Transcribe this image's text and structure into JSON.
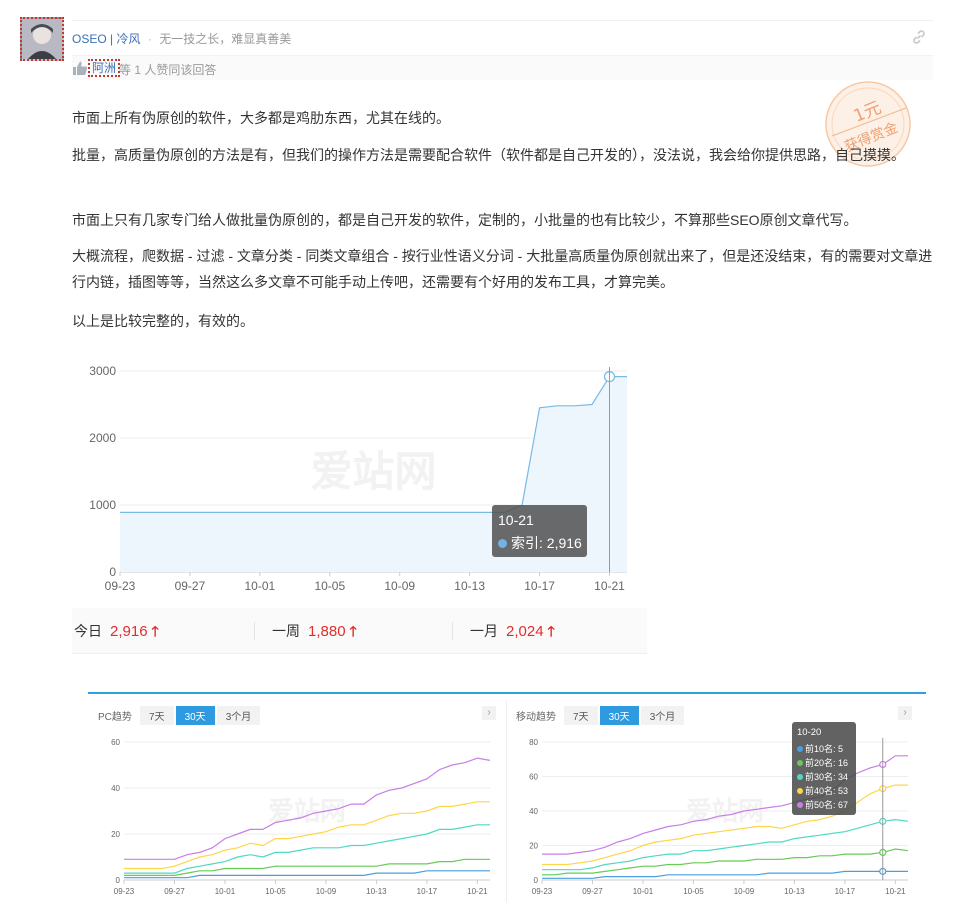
{
  "header": {
    "user_name": "OSEO",
    "separator": "|",
    "user_alias": "冷风",
    "dot": "·",
    "motto": "无一技之长，难显真善美",
    "voter": "阿洲",
    "vote_text": "等 1 人赞同该回答",
    "stamp_line1": "1元",
    "stamp_line2": "获得赏金"
  },
  "answer": {
    "paragraphs": [
      "市面上所有伪原创的软件，大多都是鸡肋东西，尤其在线的。",
      "批量，高质量伪原创的方法是有，但我们的操作方法是需要配合软件（软件都是自己开发的），没法说，我会给你提供思路，自己摸摸。",
      "市面上只有几家专门给人做批量伪原创的，都是自己开发的软件，定制的，小批量的也有比较少，不算那些SEO原创文章代写。",
      "大概流程，爬数据 - 过滤 - 文章分类 - 同类文章组合 - 按行业性语义分词 - 大批量高质量伪原创就出来了，但是还没结束，有的需要对文章进行内链，插图等等，当然这么多文章不可能手动上传吧，还需要有个好用的发布工具，才算完美。",
      "以上是比较完整的，有效的。"
    ]
  },
  "chart_data": [
    {
      "type": "area",
      "x": [
        "09-23",
        "09-24",
        "09-25",
        "09-26",
        "09-27",
        "09-28",
        "09-29",
        "09-30",
        "10-01",
        "10-02",
        "10-03",
        "10-04",
        "10-05",
        "10-06",
        "10-07",
        "10-08",
        "10-09",
        "10-10",
        "10-11",
        "10-12",
        "10-13",
        "10-14",
        "10-15",
        "10-16",
        "10-17",
        "10-18",
        "10-19",
        "10-20",
        "10-21",
        "10-22"
      ],
      "series": [
        {
          "name": "索引",
          "values": [
            890,
            890,
            890,
            890,
            890,
            890,
            890,
            890,
            890,
            890,
            890,
            890,
            890,
            890,
            890,
            890,
            890,
            890,
            890,
            890,
            890,
            890,
            890,
            1000,
            2450,
            2480,
            2480,
            2500,
            2916,
            2916
          ]
        }
      ],
      "xticks": [
        "09-23",
        "09-27",
        "10-01",
        "10-05",
        "10-09",
        "10-13",
        "10-17",
        "10-21"
      ],
      "yticks": [
        "0",
        "1000",
        "2000",
        "3000"
      ],
      "ylim": [
        0,
        3000
      ],
      "watermark": "爱站网",
      "tooltip": {
        "date": "10-21",
        "label": "索引: 2,916"
      }
    },
    {
      "type": "line",
      "title": "PC趋势",
      "x": [
        "09-23",
        "09-24",
        "09-25",
        "09-26",
        "09-27",
        "09-28",
        "09-29",
        "09-30",
        "10-01",
        "10-02",
        "10-03",
        "10-04",
        "10-05",
        "10-06",
        "10-07",
        "10-08",
        "10-09",
        "10-10",
        "10-11",
        "10-12",
        "10-13",
        "10-14",
        "10-15",
        "10-16",
        "10-17",
        "10-18",
        "10-19",
        "10-20",
        "10-21",
        "10-22"
      ],
      "xticks": [
        "09-23",
        "09-27",
        "10-01",
        "10-05",
        "10-09",
        "10-13",
        "10-17",
        "10-21"
      ],
      "yticks": [
        "0",
        "20",
        "40",
        "60"
      ],
      "ylim": [
        0,
        60
      ],
      "watermark": "爱站网",
      "series": [
        {
          "name": "前10名",
          "color": "#4a9fe0",
          "values": [
            1,
            1,
            1,
            1,
            1,
            1,
            2,
            2,
            2,
            2,
            2,
            2,
            2,
            2,
            2,
            2,
            2,
            2,
            2,
            2,
            3,
            3,
            3,
            3,
            4,
            4,
            4,
            4,
            4,
            4
          ]
        },
        {
          "name": "前20名",
          "color": "#66cc55",
          "values": [
            2,
            2,
            2,
            2,
            2,
            3,
            4,
            4,
            5,
            5,
            5,
            5,
            6,
            6,
            6,
            6,
            6,
            6,
            6,
            6,
            6,
            7,
            7,
            7,
            7,
            8,
            8,
            9,
            9,
            9
          ]
        },
        {
          "name": "前30名",
          "color": "#4fd9c4",
          "values": [
            3,
            3,
            3,
            3,
            3,
            5,
            6,
            7,
            8,
            10,
            11,
            10,
            12,
            12,
            13,
            14,
            14,
            14,
            15,
            15,
            16,
            17,
            18,
            19,
            20,
            22,
            22,
            23,
            24,
            24
          ]
        },
        {
          "name": "前40名",
          "color": "#ffd54a",
          "values": [
            5,
            5,
            5,
            5,
            6,
            8,
            10,
            11,
            13,
            14,
            16,
            15,
            18,
            18,
            19,
            20,
            21,
            23,
            24,
            24,
            26,
            28,
            29,
            29,
            30,
            32,
            32,
            33,
            34,
            34
          ]
        },
        {
          "name": "前50名",
          "color": "#c77ee8",
          "values": [
            9,
            9,
            9,
            9,
            9,
            11,
            12,
            14,
            18,
            20,
            22,
            22,
            25,
            26,
            27,
            29,
            30,
            31,
            33,
            33,
            37,
            39,
            40,
            42,
            44,
            48,
            50,
            51,
            53,
            52
          ]
        }
      ]
    },
    {
      "type": "line",
      "title": "移动趋势",
      "x": [
        "09-23",
        "09-24",
        "09-25",
        "09-26",
        "09-27",
        "09-28",
        "09-29",
        "09-30",
        "10-01",
        "10-02",
        "10-03",
        "10-04",
        "10-05",
        "10-06",
        "10-07",
        "10-08",
        "10-09",
        "10-10",
        "10-11",
        "10-12",
        "10-13",
        "10-14",
        "10-15",
        "10-16",
        "10-17",
        "10-18",
        "10-19",
        "10-20",
        "10-21",
        "10-22"
      ],
      "xticks": [
        "09-23",
        "09-27",
        "10-01",
        "10-05",
        "10-09",
        "10-13",
        "10-17",
        "10-21"
      ],
      "yticks": [
        "0",
        "20",
        "40",
        "60",
        "80"
      ],
      "ylim": [
        0,
        80
      ],
      "watermark": "爱站网",
      "series": [
        {
          "name": "前10名",
          "color": "#4a9fe0",
          "values": [
            1,
            1,
            1,
            1,
            1,
            2,
            2,
            2,
            2,
            2,
            3,
            3,
            3,
            3,
            3,
            3,
            3,
            3,
            4,
            4,
            4,
            4,
            4,
            4,
            5,
            5,
            5,
            5,
            5,
            5
          ]
        },
        {
          "name": "前20名",
          "color": "#66cc55",
          "values": [
            3,
            3,
            4,
            4,
            4,
            5,
            6,
            7,
            8,
            8,
            9,
            9,
            10,
            10,
            11,
            11,
            11,
            12,
            12,
            12,
            13,
            13,
            14,
            14,
            15,
            15,
            15,
            16,
            18,
            17
          ]
        },
        {
          "name": "前30名",
          "color": "#4fd9c4",
          "values": [
            6,
            6,
            6,
            6,
            7,
            9,
            10,
            11,
            13,
            14,
            15,
            15,
            17,
            17,
            18,
            19,
            20,
            21,
            22,
            22,
            24,
            25,
            26,
            27,
            28,
            30,
            32,
            34,
            35,
            34
          ]
        },
        {
          "name": "前40名",
          "color": "#ffd54a",
          "values": [
            9,
            9,
            9,
            10,
            11,
            13,
            15,
            17,
            20,
            22,
            23,
            24,
            26,
            27,
            28,
            29,
            30,
            31,
            31,
            30,
            32,
            34,
            35,
            37,
            40,
            45,
            50,
            53,
            55,
            55
          ]
        },
        {
          "name": "前50名",
          "color": "#c77ee8",
          "values": [
            15,
            15,
            15,
            16,
            17,
            19,
            22,
            24,
            27,
            29,
            31,
            32,
            34,
            35,
            37,
            38,
            40,
            41,
            42,
            43,
            45,
            47,
            48,
            52,
            58,
            62,
            65,
            67,
            72,
            72
          ]
        }
      ],
      "tooltip": {
        "date": "10-20",
        "rows": [
          "前10名: 5",
          "前20名: 16",
          "前30名: 34",
          "前40名: 53",
          "前50名: 67"
        ]
      }
    }
  ],
  "stats": {
    "today_label": "今日",
    "today_value": "2,916",
    "week_label": "一周",
    "week_value": "1,880",
    "month_label": "一月",
    "month_value": "2,024",
    "up_arrow": "🡑"
  },
  "panels": {
    "tab_7": "7天",
    "tab_30": "30天",
    "tab_3m": "3个月",
    "nav": "›"
  },
  "colors": {
    "accent": "#2e9be0",
    "link": "#3b6fb6",
    "up": "#e02d2d"
  }
}
